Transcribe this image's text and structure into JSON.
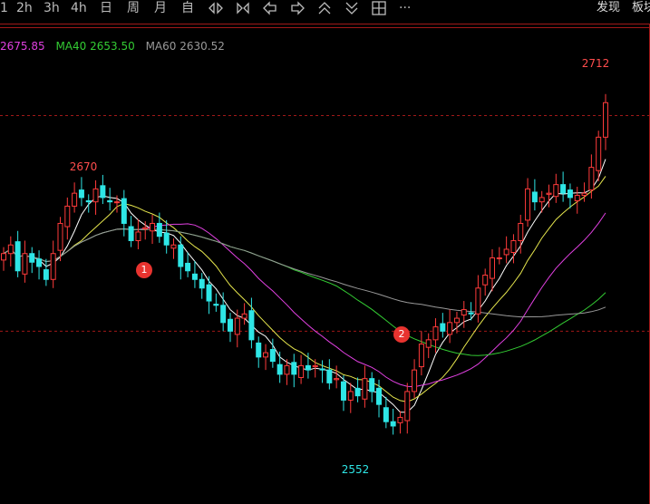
{
  "toolbar": {
    "items": [
      "2h",
      "3h",
      "4h",
      "日",
      "周",
      "月",
      "自"
    ],
    "icons": [
      "expand-horizontal-icon",
      "collapse-horizontal-icon",
      "arrow-left-icon",
      "arrow-right-icon",
      "chevrons-up-icon",
      "chevrons-down-icon",
      "layout-grid-icon",
      "more-icon"
    ],
    "more_label": "···",
    "right": [
      "发现",
      "板块"
    ]
  },
  "indicators": {
    "ma_first_value": "2675.85",
    "ma40": "MA40 2653.50",
    "ma60": "MA60 2630.52",
    "colors": {
      "ma_first": "#e040e0",
      "ma40": "#33cc33",
      "ma60": "#999999"
    }
  },
  "annotations": {
    "high": "2712",
    "high_left": "2670",
    "low": "2552",
    "marker1": "1",
    "marker2": "2"
  },
  "chart_data": {
    "type": "candlestick",
    "colors": {
      "up": "#ff3b3b",
      "down": "#2ee6e6",
      "ma5": "#ffffff",
      "ma10": "#e6e64d",
      "ma20": "#e040e0",
      "ma40": "#33cc33",
      "ma60": "#999999"
    },
    "price_range": [
      2540,
      2720
    ],
    "ref_lines": [
      2700,
      2600
    ],
    "closes": [
      2636,
      2640,
      2628,
      2636,
      2632,
      2630,
      2624,
      2636,
      2650,
      2658,
      2664,
      2662,
      2660,
      2666,
      2662,
      2660,
      2660,
      2650,
      2642,
      2646,
      2648,
      2650,
      2644,
      2640,
      2640,
      2630,
      2628,
      2624,
      2620,
      2614,
      2612,
      2604,
      2600,
      2606,
      2608,
      2596,
      2588,
      2590,
      2586,
      2580,
      2584,
      2580,
      2584,
      2582,
      2584,
      2582,
      2576,
      2578,
      2568,
      2572,
      2570,
      2578,
      2572,
      2566,
      2558,
      2556,
      2560,
      2572,
      2582,
      2594,
      2596,
      2602,
      2600,
      2604,
      2606,
      2610,
      2608,
      2620,
      2626,
      2634,
      2634,
      2638,
      2642,
      2650,
      2666,
      2660,
      2662,
      2664,
      2668,
      2664,
      2662,
      2663,
      2664,
      2676,
      2690,
      2706
    ]
  }
}
